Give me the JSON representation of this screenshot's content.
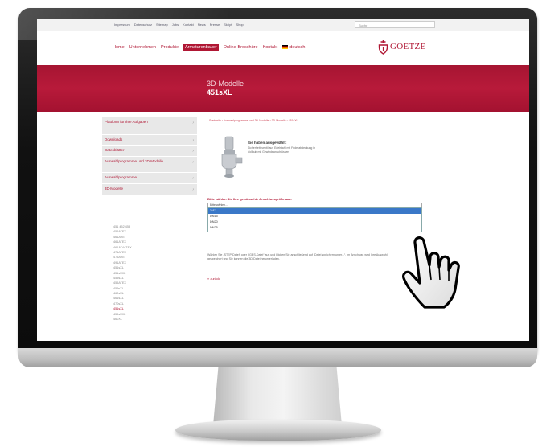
{
  "top_links": [
    "Impressum",
    "Datenschutz",
    "Sitemap",
    "Jobs",
    "Kontakt",
    "News",
    "Presse",
    "Skript",
    "Shop"
  ],
  "search": {
    "placeholder": "Suche"
  },
  "nav": {
    "items": [
      "Home",
      "Unternehmen",
      "Produkte",
      "Armaturenbauer",
      "Online-Broschüre",
      "Kontakt"
    ],
    "active_index": 3,
    "language": "deutsch"
  },
  "logo": {
    "text": "GOETZE",
    "color": "#b01734"
  },
  "banner": {
    "title": "3D-Modelle",
    "subtitle": "451sXL",
    "color": "#b01734"
  },
  "sidebar": {
    "items": [
      "Plattform für Ihre Aufgaben",
      "Downloads",
      "Datenblätter",
      "Auswahlprogramme und 3D-Modelle",
      "Auswahlprogramme",
      "3D-Modelle"
    ],
    "models": [
      "451 452 453",
      "459ATEX",
      "461AXE",
      "461ATEX",
      "461AT4ATEX",
      "471ATEX",
      "475AXE",
      "491ATEX",
      "451sXL",
      "451sXXL",
      "455sXL",
      "455ATEX",
      "459sXL",
      "460sXL",
      "461sXL",
      "470sXL",
      "451sXL",
      "455sXXL",
      "460XL"
    ],
    "selected_model_index": 16
  },
  "content": {
    "breadcrumb": "Startseite › Auswahlprogramme und 3D-Modelle › 3D-Modelle › 451sXL",
    "product_heading": "Sie haben ausgewählt:",
    "product_desc": "Sicherheitsventil aus Edelstahl mit Federabdeckung in Vollhub mit Gewindeanschlüssen",
    "select_label": "Bitte wählen Sie Ihre gewünschte Anschlussgröße aus:",
    "select_value": "Bitte wählen...",
    "options": [
      "3/4\"",
      "DN15",
      "DN20",
      "DN25"
    ],
    "highlighted_option": 0,
    "notice": "Wählen Sie „STEP-Datei“ oder „IGES-Datei“ aus und klicken Sie anschließend auf „Datei speichern unter...“. Im Anschluss wird Ihre Auswahl gespeichert und Sie können die 3D-Datei herunterladen.",
    "back_link": "« zurück"
  }
}
